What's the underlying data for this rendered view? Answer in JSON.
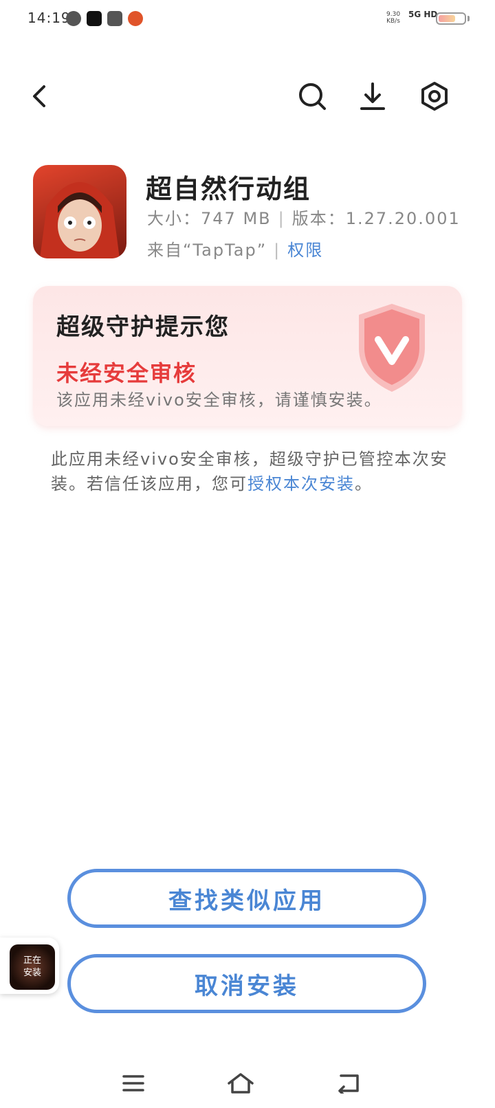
{
  "status_bar": {
    "time": "14:19",
    "speed_value": "9.30",
    "speed_unit": "KB/s",
    "network": "5G HD"
  },
  "toolbar": {
    "back_icon": "chevron-left-icon",
    "search_icon": "search-icon",
    "download_icon": "download-icon",
    "settings_icon": "gear-hex-icon"
  },
  "app": {
    "name": "超自然行动组",
    "size_label": "大小：",
    "size_value": "747 MB",
    "version_label": "版本：",
    "version_value": "1.27.20.001",
    "source": "来自“TapTap”",
    "permissions_link": "权限"
  },
  "security_card": {
    "title": "超级守护提示您",
    "warning": "未经安全审核",
    "description": "该应用未经vivo安全审核，请谨慎安装。"
  },
  "explain": {
    "text": "此应用未经vivo安全审核，超级守护已管控本次安装。若信任该应用，您可",
    "link": "授权本次安装",
    "suffix": "。"
  },
  "buttons": {
    "find_similar": "查找类似应用",
    "cancel_install": "取消安装"
  },
  "floating_badge": {
    "line1": "正在",
    "line2": "安装"
  },
  "colors": {
    "accent": "#4a86d4",
    "warning": "#e63c3c",
    "card_bg": "#fde6e6"
  }
}
